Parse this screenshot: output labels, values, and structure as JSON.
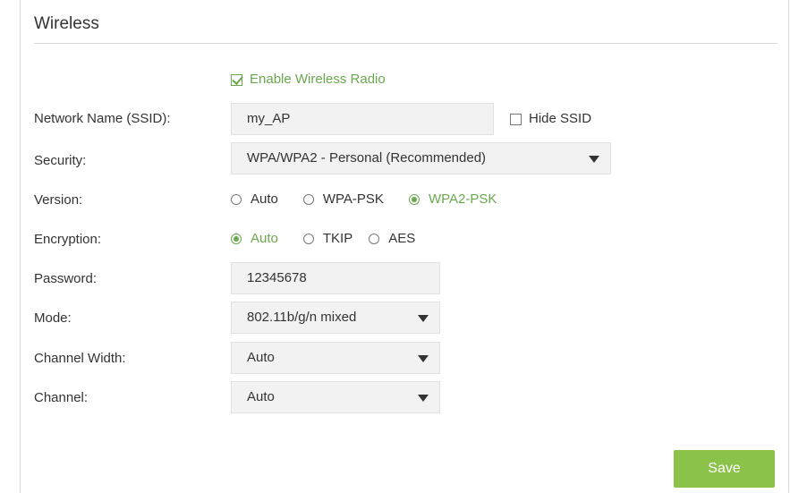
{
  "section": {
    "title": "Wireless"
  },
  "enable_radio": {
    "label": "Enable Wireless Radio",
    "checked": true
  },
  "ssid": {
    "label": "Network Name (SSID):",
    "value": "my_AP",
    "hide_label": "Hide SSID",
    "hide_checked": false
  },
  "security": {
    "label": "Security:",
    "value": "WPA/WPA2 - Personal (Recommended)"
  },
  "version": {
    "label": "Version:",
    "options": [
      "Auto",
      "WPA-PSK",
      "WPA2-PSK"
    ],
    "selected": "WPA2-PSK"
  },
  "encryption": {
    "label": "Encryption:",
    "options": [
      "Auto",
      "TKIP",
      "AES"
    ],
    "selected": "Auto"
  },
  "password": {
    "label": "Password:",
    "value": "12345678"
  },
  "mode": {
    "label": "Mode:",
    "value": "802.11b/g/n mixed"
  },
  "channel_width": {
    "label": "Channel Width:",
    "value": "Auto"
  },
  "channel": {
    "label": "Channel:",
    "value": "Auto"
  },
  "save": {
    "label": "Save"
  },
  "colors": {
    "accent": "#6aa84f",
    "button": "#8bc34a"
  }
}
